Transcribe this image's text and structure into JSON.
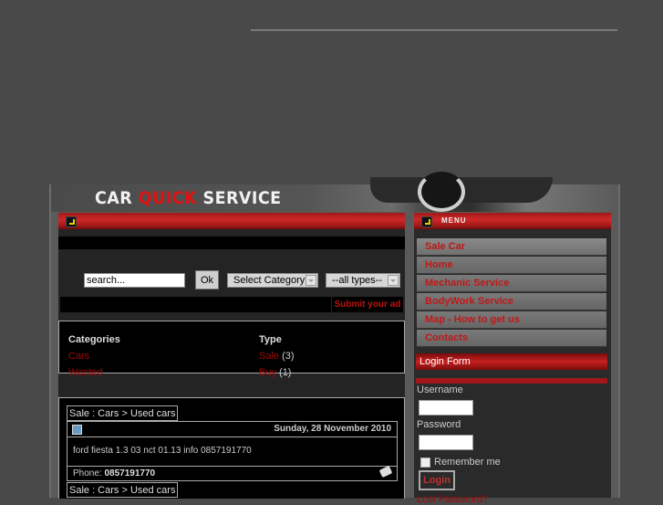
{
  "header": {
    "logo": {
      "part1": "CAR",
      "part2": "QUICK",
      "part3": "SERVICE"
    },
    "brand_colors": {
      "accent_red": "#e01010",
      "bar_red": "#c82020",
      "link_red": "#a00808"
    }
  },
  "search": {
    "input_value": "search...",
    "ok_label": "Ok",
    "category_select": "Select Category",
    "type_select": "--all types--",
    "submit_ad_label": "Submit your ad"
  },
  "categories": {
    "header": "Categories",
    "items": [
      "Cars",
      "Wanted"
    ]
  },
  "types": {
    "header": "Type",
    "items": [
      {
        "label": "Sale",
        "count": "(3)"
      },
      {
        "label": "Buy",
        "count": "(1)"
      }
    ]
  },
  "ads": [
    {
      "breadcrumb": "Sale : Cars > Used cars",
      "date": "Sunday, 28 November 2010",
      "text": "ford fiesta 1.3 03 nct 01.13 info 0857191770",
      "phone_label": "Phone:",
      "phone": "0857191770"
    },
    {
      "breadcrumb": "Sale : Cars > Used cars"
    }
  ],
  "menu": {
    "title": "MENU",
    "items": [
      "Sale Car",
      "Home",
      "Mechanic Service",
      "BodyWork Service",
      "Map - How to get us",
      "Contacts"
    ]
  },
  "login": {
    "title": "Login Form",
    "username_label": "Username",
    "username_value": "",
    "password_label": "Password",
    "password_value": "",
    "remember_label": "Remember me",
    "login_button": "Login",
    "lost_password": "Lost Password?"
  }
}
